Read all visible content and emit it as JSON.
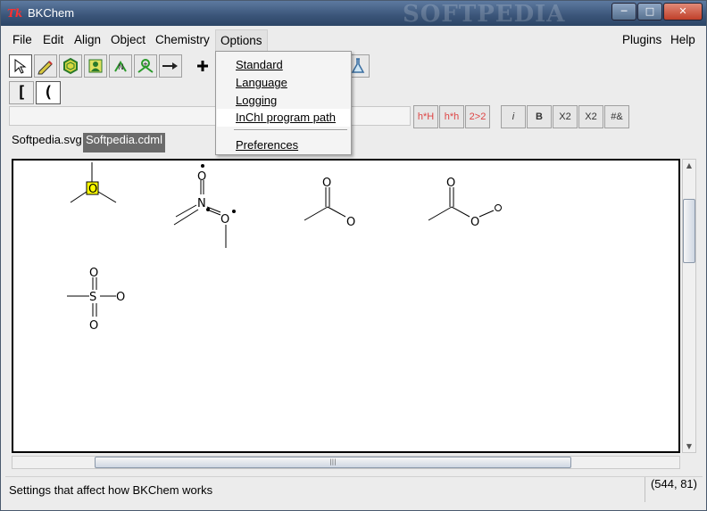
{
  "window": {
    "title": "BKChem",
    "watermark": "SOFTPEDIA",
    "minimize": "─",
    "maximize": "□",
    "close": "✕"
  },
  "menubar": {
    "file": "File",
    "edit": "Edit",
    "align": "Align",
    "object": "Object",
    "chemistry": "Chemistry",
    "options": "Options",
    "plugins": "Plugins",
    "help": "Help"
  },
  "options_menu": {
    "items": [
      "Standard",
      "Language",
      "Logging",
      "InChI program path",
      "Preferences"
    ]
  },
  "toolbar": {
    "icons": [
      "arrow-icon",
      "pencil-icon",
      "template-icon",
      "user-template-icon",
      "atom-symbol-icon",
      "vector-icon",
      "arrow-right-icon",
      "plus-icon",
      "flask-icon"
    ],
    "brackets": [
      "[ ]",
      "( )"
    ]
  },
  "text_format_buttons": [
    "h*H",
    "h*h",
    "2>2",
    "i",
    "B",
    "X2",
    "X2",
    "#&"
  ],
  "tabs": [
    {
      "label": "Softpedia.svg",
      "active": false
    },
    {
      "label": "Softpedia.cdml",
      "active": true
    }
  ],
  "canvas_labels": {
    "o_boxed": "O",
    "nitro_o_top": "O",
    "nitro_n": "N",
    "nitro_o_right": "O",
    "acetate_o_top": "O",
    "acetate_o": "O",
    "ester_o_top": "O",
    "ester_o": "O",
    "sulfonyl_o_top": "O",
    "sulfonyl_s": "S",
    "sulfonyl_o_right": "O",
    "sulfonyl_o_bottom": "O"
  },
  "statusbar": {
    "message": "Settings that affect how BKChem works",
    "coords": "(544, 81)"
  },
  "colors": {
    "accent_highlight": "#ffff00",
    "active_tab": "#6b6b6b",
    "title_gradient": "#3a5478"
  }
}
